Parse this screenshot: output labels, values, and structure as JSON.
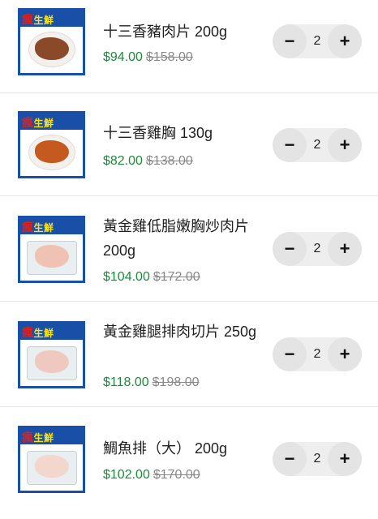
{
  "brand": {
    "mark": "瘋",
    "text": "生鮮",
    "prefix": "天"
  },
  "colors": {
    "price": "#1d8a3c",
    "brand_blue": "#1a4fa8"
  },
  "items": [
    {
      "name": "十三香豬肉片 200g",
      "price": "$94.00",
      "original_price": "$158.00",
      "quantity": "2",
      "decrement": "−",
      "increment": "+"
    },
    {
      "name": "十三香雞胸 130g",
      "price": "$82.00",
      "original_price": "$138.00",
      "quantity": "2",
      "decrement": "−",
      "increment": "+"
    },
    {
      "name": "黃金雞低脂嫩胸炒肉片 200g",
      "price": "$104.00",
      "original_price": "$172.00",
      "quantity": "2",
      "decrement": "−",
      "increment": "+"
    },
    {
      "name": "黃金雞腿排肉切片 250g",
      "price": "$118.00",
      "original_price": "$198.00",
      "quantity": "2",
      "decrement": "−",
      "increment": "+"
    },
    {
      "name": "鯛魚排（大） 200g",
      "price": "$102.00",
      "original_price": "$170.00",
      "quantity": "2",
      "decrement": "−",
      "increment": "+"
    }
  ]
}
